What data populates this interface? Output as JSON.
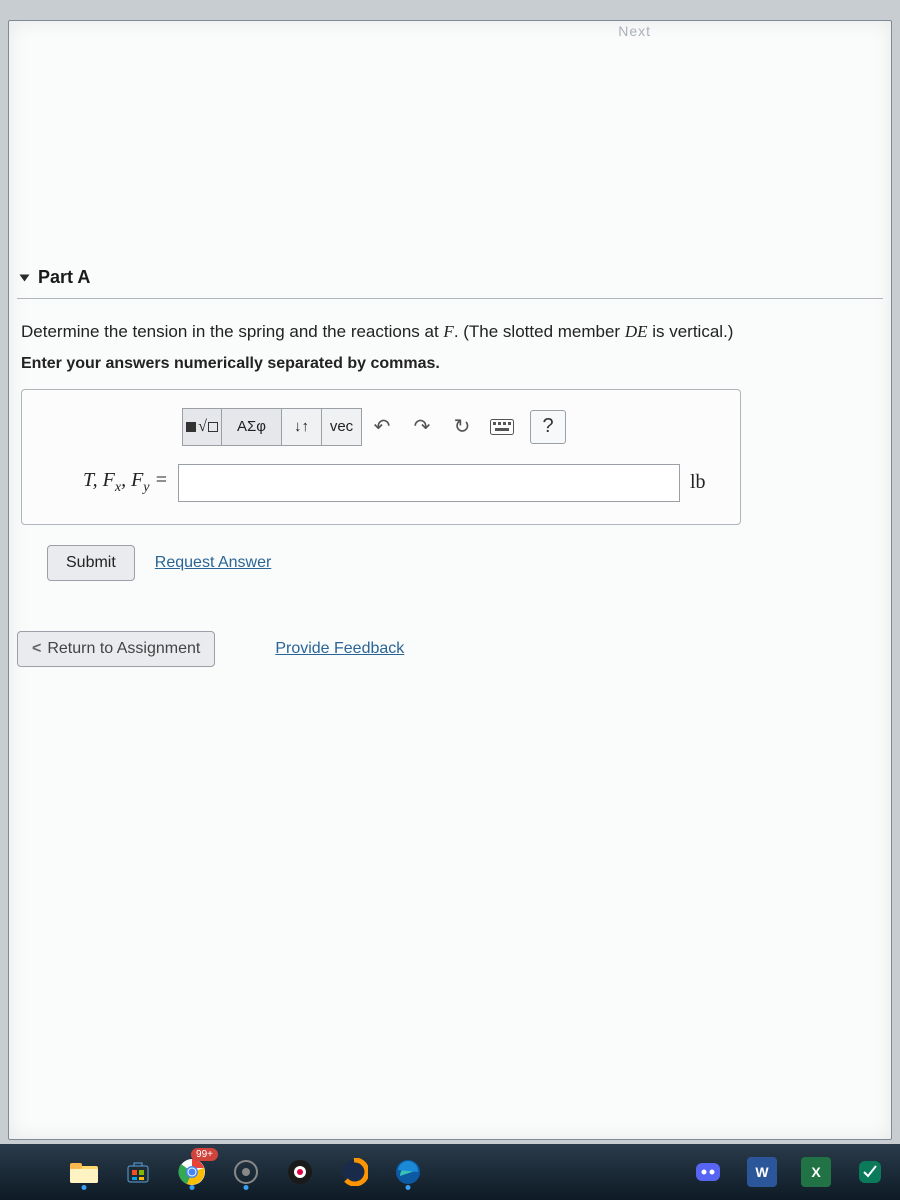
{
  "nav_hint": "Next",
  "part": {
    "label": "Part A"
  },
  "prompt": {
    "line1_a": "Determine the tension in the spring and the reactions at ",
    "line1_var": "F",
    "line1_b": ". (The slotted member ",
    "line1_var2": "DE",
    "line1_c": " is vertical.)",
    "instruction": "Enter your answers numerically separated by commas."
  },
  "toolbar": {
    "templates": "□√□",
    "greek": "ΑΣφ",
    "subsup": "↓↑",
    "vec": "vec",
    "undo": "↶",
    "redo": "↷",
    "reset": "↻",
    "keyboard": "⌨",
    "help": "?"
  },
  "answer": {
    "lhs_T": "T",
    "lhs_Fx": "F",
    "lhs_Fx_sub": "x",
    "lhs_Fy": "F",
    "lhs_Fy_sub": "y",
    "equals": " = ",
    "value": "",
    "unit": "lb"
  },
  "buttons": {
    "submit": "Submit",
    "request": "Request Answer",
    "return": "Return to Assignment",
    "feedback": "Provide Feedback"
  },
  "taskbar": {
    "chrome_badge": "99+",
    "word": "W",
    "excel": "X"
  }
}
